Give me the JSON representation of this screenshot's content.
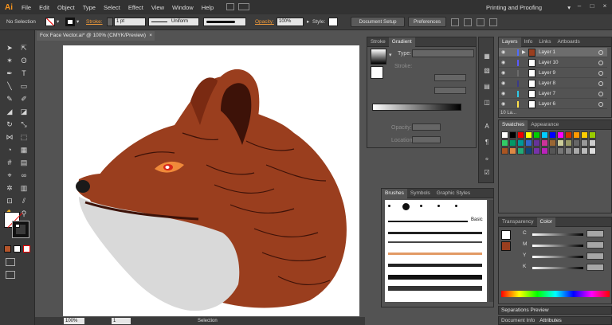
{
  "app": {
    "logo": "Ai",
    "workspace": "Printing and Proofing"
  },
  "menu": [
    "File",
    "Edit",
    "Object",
    "Type",
    "Select",
    "Effect",
    "View",
    "Window",
    "Help"
  ],
  "control": {
    "selection": "No Selection",
    "stroke_label": "Stroke:",
    "stroke_value": "1 pt",
    "profile": "Uniform",
    "opacity_label": "Opacity:",
    "opacity_value": "100%",
    "style_label": "Style:",
    "document_setup": "Document Setup",
    "preferences": "Preferences"
  },
  "document": {
    "tab_title": "Fox Face Vector.ai* @ 100% (CMYK/Preview)",
    "close": "×"
  },
  "status": {
    "zoom": "100%",
    "artboard": "1",
    "tool": "Selection"
  },
  "gradient_panel": {
    "tabs": [
      "Stroke",
      "Gradient"
    ],
    "type_label": "Type:",
    "stroke_label": "Stroke:",
    "opacity_label": "Opacity:",
    "location_label": "Location:"
  },
  "brushes_panel": {
    "tabs": [
      "Brushes",
      "Symbols",
      "Graphic Styles"
    ],
    "basic_label": "Basic"
  },
  "layers_panel": {
    "tabs": [
      "Layers",
      "Info",
      "Links",
      "Artboards"
    ],
    "layers": [
      {
        "name": "Layer 1",
        "color": "#4f6bff",
        "selected": true
      },
      {
        "name": "Layer 10",
        "color": "#5a5aff",
        "selected": false
      },
      {
        "name": "Layer 9",
        "color": "#6b6b6b",
        "selected": false
      },
      {
        "name": "Layer 8",
        "color": "#3a3a8a",
        "selected": false
      },
      {
        "name": "Layer 7",
        "color": "#2ec9e8",
        "selected": false
      },
      {
        "name": "Layer 6",
        "color": "#ffe14a",
        "selected": false
      }
    ],
    "footer": "10 La..."
  },
  "swatches_panel": {
    "tabs": [
      "Swatches",
      "Appearance"
    ]
  },
  "color_panel": {
    "tabs": [
      "Transparency",
      "Color"
    ],
    "channels": [
      "C",
      "M",
      "Y",
      "K"
    ]
  },
  "separations": {
    "title": "Separations Preview"
  },
  "bottom_tabs": [
    "Document Info",
    "Attributes"
  ],
  "colors": {
    "fox_fur": "#9a3e1e",
    "fox_dark": "#3d1208",
    "fox_white": "#d9d9d9",
    "accent": "#f29b3a"
  }
}
